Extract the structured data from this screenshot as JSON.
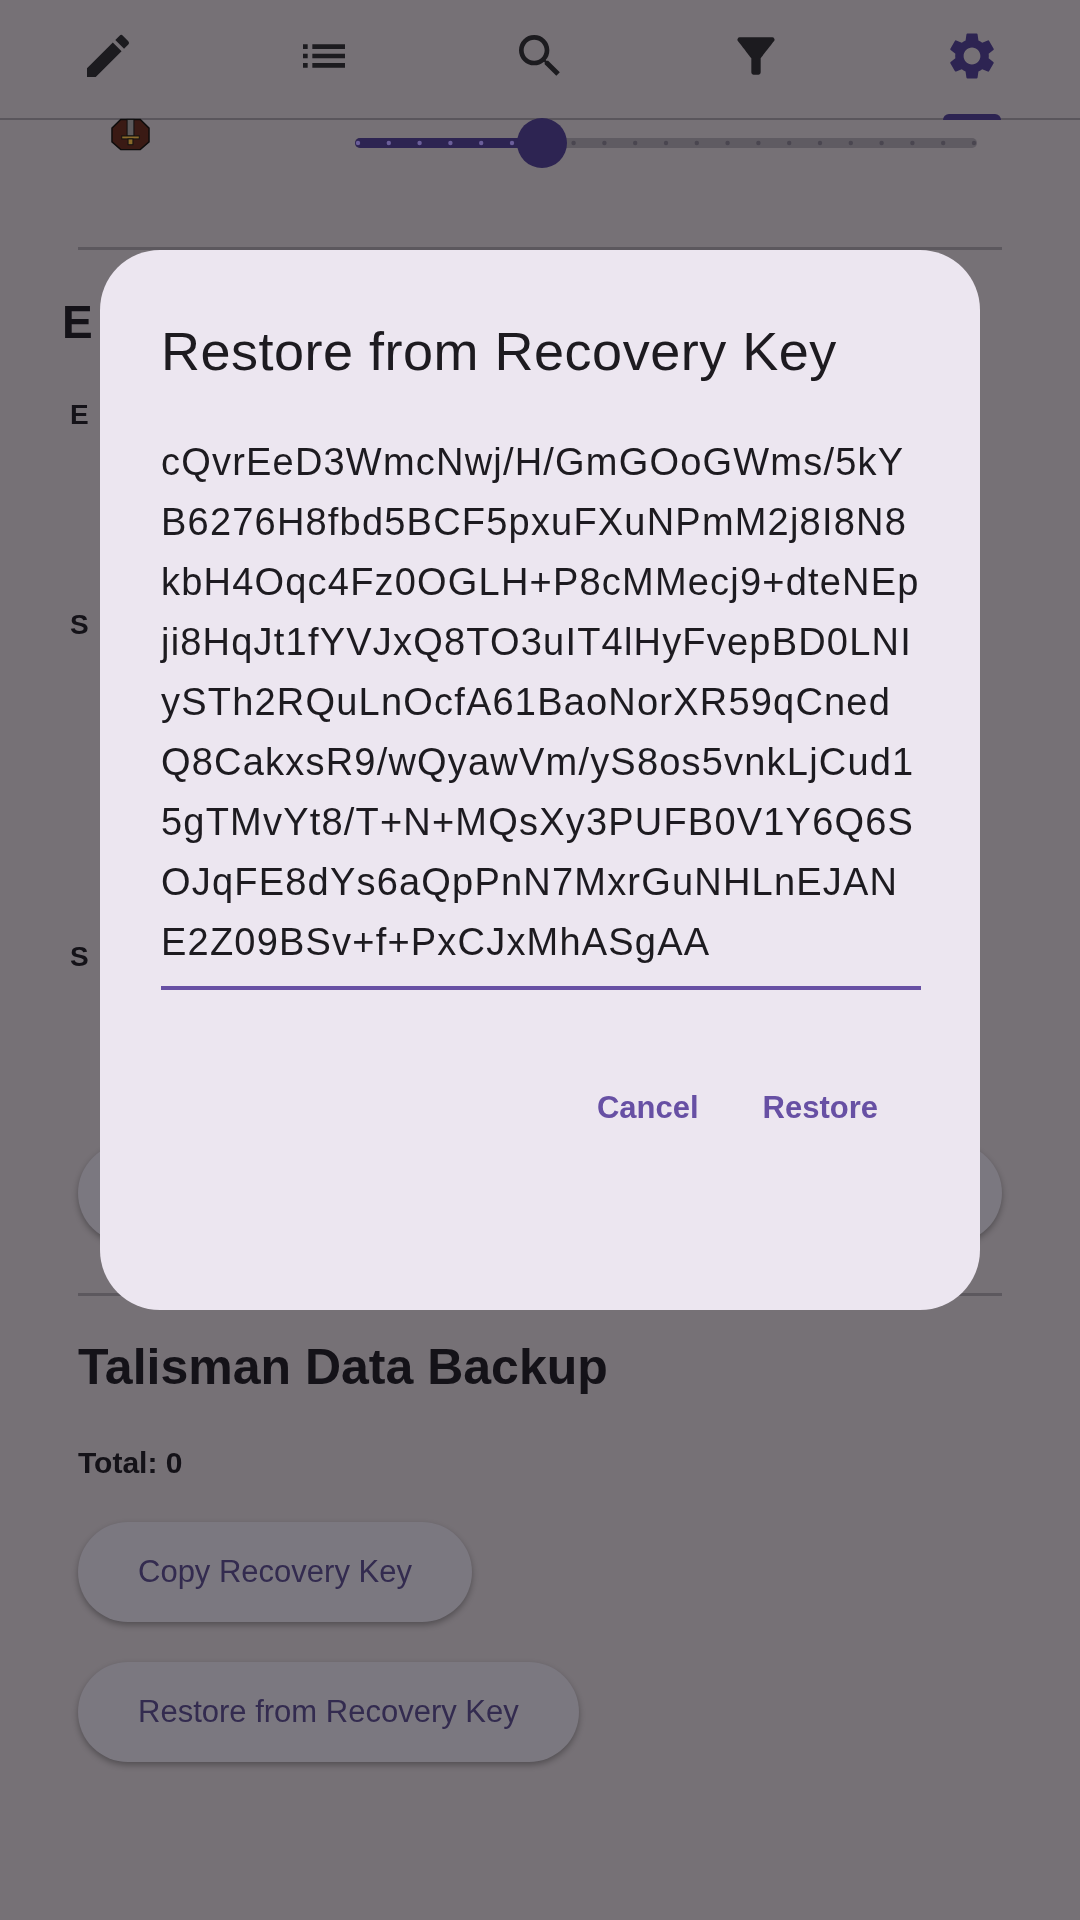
{
  "nav_tabs": [
    {
      "kind": "edit",
      "selected": false
    },
    {
      "kind": "list",
      "selected": false
    },
    {
      "kind": "search",
      "selected": false
    },
    {
      "kind": "filter",
      "selected": false
    },
    {
      "kind": "settings",
      "selected": true
    }
  ],
  "slider": {
    "level": 0.3
  },
  "covered_texts": [
    {
      "kind": "heading",
      "text": "E"
    },
    {
      "kind": "label",
      "text": "E"
    },
    {
      "kind": "label",
      "text": "S"
    },
    {
      "kind": "label",
      "text": "S"
    }
  ],
  "backup_section": {
    "title": "Talisman Data Backup",
    "total": "Total: 0",
    "buttons": [
      "Copy Recovery Key",
      "Restore from Recovery Key"
    ]
  },
  "dialog": {
    "title": "Restore from Recovery Key",
    "value": "cQvrEeD3WmcNwj/H/GmGOoGWms/5kYB6276H8fbd5BCF5pxuFXuNPmM2j8I8N8kbH4Oqc4Fz0OGLH+P8cMMecj9+dteNEpji8HqJt1fYVJxQ8TO3uIT4lHyFvepBD0LNIySTh2RQuLnOcfA61BaoNorXR59qCnedQ8CakxsR9/wQyawVm/yS8os5vnkLjCud15gTMvYt8/T+N+MQsXy3PUFB0V1Y6Q6SOJqFE8dYs6aQpPnN7MxrGuNHLnEJANE2Z09BSv+f+PxCJxMhASgAA",
    "actions": [
      "Cancel",
      "Restore"
    ]
  }
}
